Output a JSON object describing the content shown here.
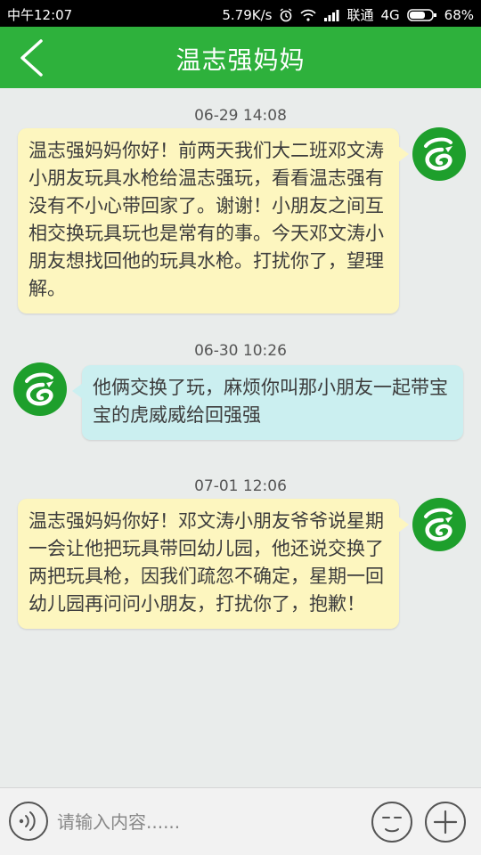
{
  "status_bar": {
    "time": "中午12:07",
    "network_speed": "5.79K/s",
    "carrier": "联通",
    "network_type": "4G",
    "battery": "68%"
  },
  "header": {
    "title": "温志强妈妈"
  },
  "messages": [
    {
      "timestamp": "06-29 14:08",
      "direction": "outgoing",
      "text": "温志强妈妈你好！前两天我们大二班邓文涛小朋友玩具水枪给温志强玩，看看温志强有没有不小心带回家了。谢谢！小朋友之间互相交换玩具玩也是常有的事。今天邓文涛小朋友想找回他的玩具水枪。打扰你了，望理解。"
    },
    {
      "timestamp": "06-30 10:26",
      "direction": "incoming",
      "text": "他俩交换了玩，麻烦你叫那小朋友一起带宝宝的虎威威给回强强"
    },
    {
      "timestamp": "07-01 12:06",
      "direction": "outgoing",
      "text": "温志强妈妈你好！邓文涛小朋友爷爷说星期一会让他把玩具带回幼儿园，他还说交换了两把玩具枪，因我们疏忽不确定，星期一回幼儿园再问问小朋友，打扰你了，抱歉！"
    }
  ],
  "input": {
    "placeholder": "请输入内容......",
    "value": ""
  },
  "colors": {
    "header_green": "#2eb13c",
    "outgoing_bubble": "#fdf6bf",
    "incoming_bubble": "#cbeff0",
    "avatar_green": "#1e9f2c"
  }
}
